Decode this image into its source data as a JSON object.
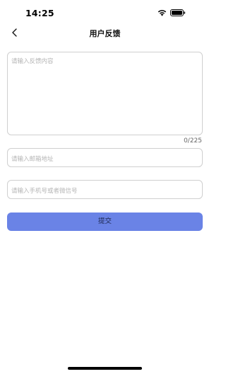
{
  "status_bar": {
    "time": "14:25",
    "wifi_icon": "wifi-icon",
    "battery_icon": "battery-icon"
  },
  "nav": {
    "title": "用户反馈",
    "back_icon": "chevron-left-icon"
  },
  "form": {
    "feedback": {
      "value": "",
      "placeholder": "请输入反馈内容",
      "counter": "0/225"
    },
    "email": {
      "value": "",
      "placeholder": "请输入邮箱地址"
    },
    "phone": {
      "value": "",
      "placeholder": "请输入手机号或者微信号"
    },
    "submit_label": "提交",
    "submit_color": "#6a83e6"
  }
}
